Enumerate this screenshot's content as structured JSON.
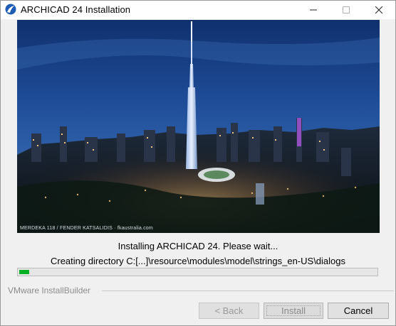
{
  "window": {
    "title": "ARCHICAD 24 Installation",
    "controls": {
      "minimize": "minimize-icon",
      "maximize": "maximize-icon",
      "close": "close-icon"
    }
  },
  "banner": {
    "caption": "MERDEKA 118 / FENDER KATSALIDIS · fkaustralia.com"
  },
  "status": {
    "heading": "Installing ARCHICAD 24. Please wait...",
    "detail": "Creating directory C:[...]\\resource\\modules\\model\\strings_en-US\\dialogs"
  },
  "progress": {
    "fraction": 0.028,
    "color": "#06b025"
  },
  "footer": {
    "brand": "VMware InstallBuilder"
  },
  "buttons": {
    "back": "< Back",
    "install": "Install",
    "cancel": "Cancel"
  },
  "colors": {
    "accent": "#1e5bb5",
    "progress": "#06b025"
  }
}
